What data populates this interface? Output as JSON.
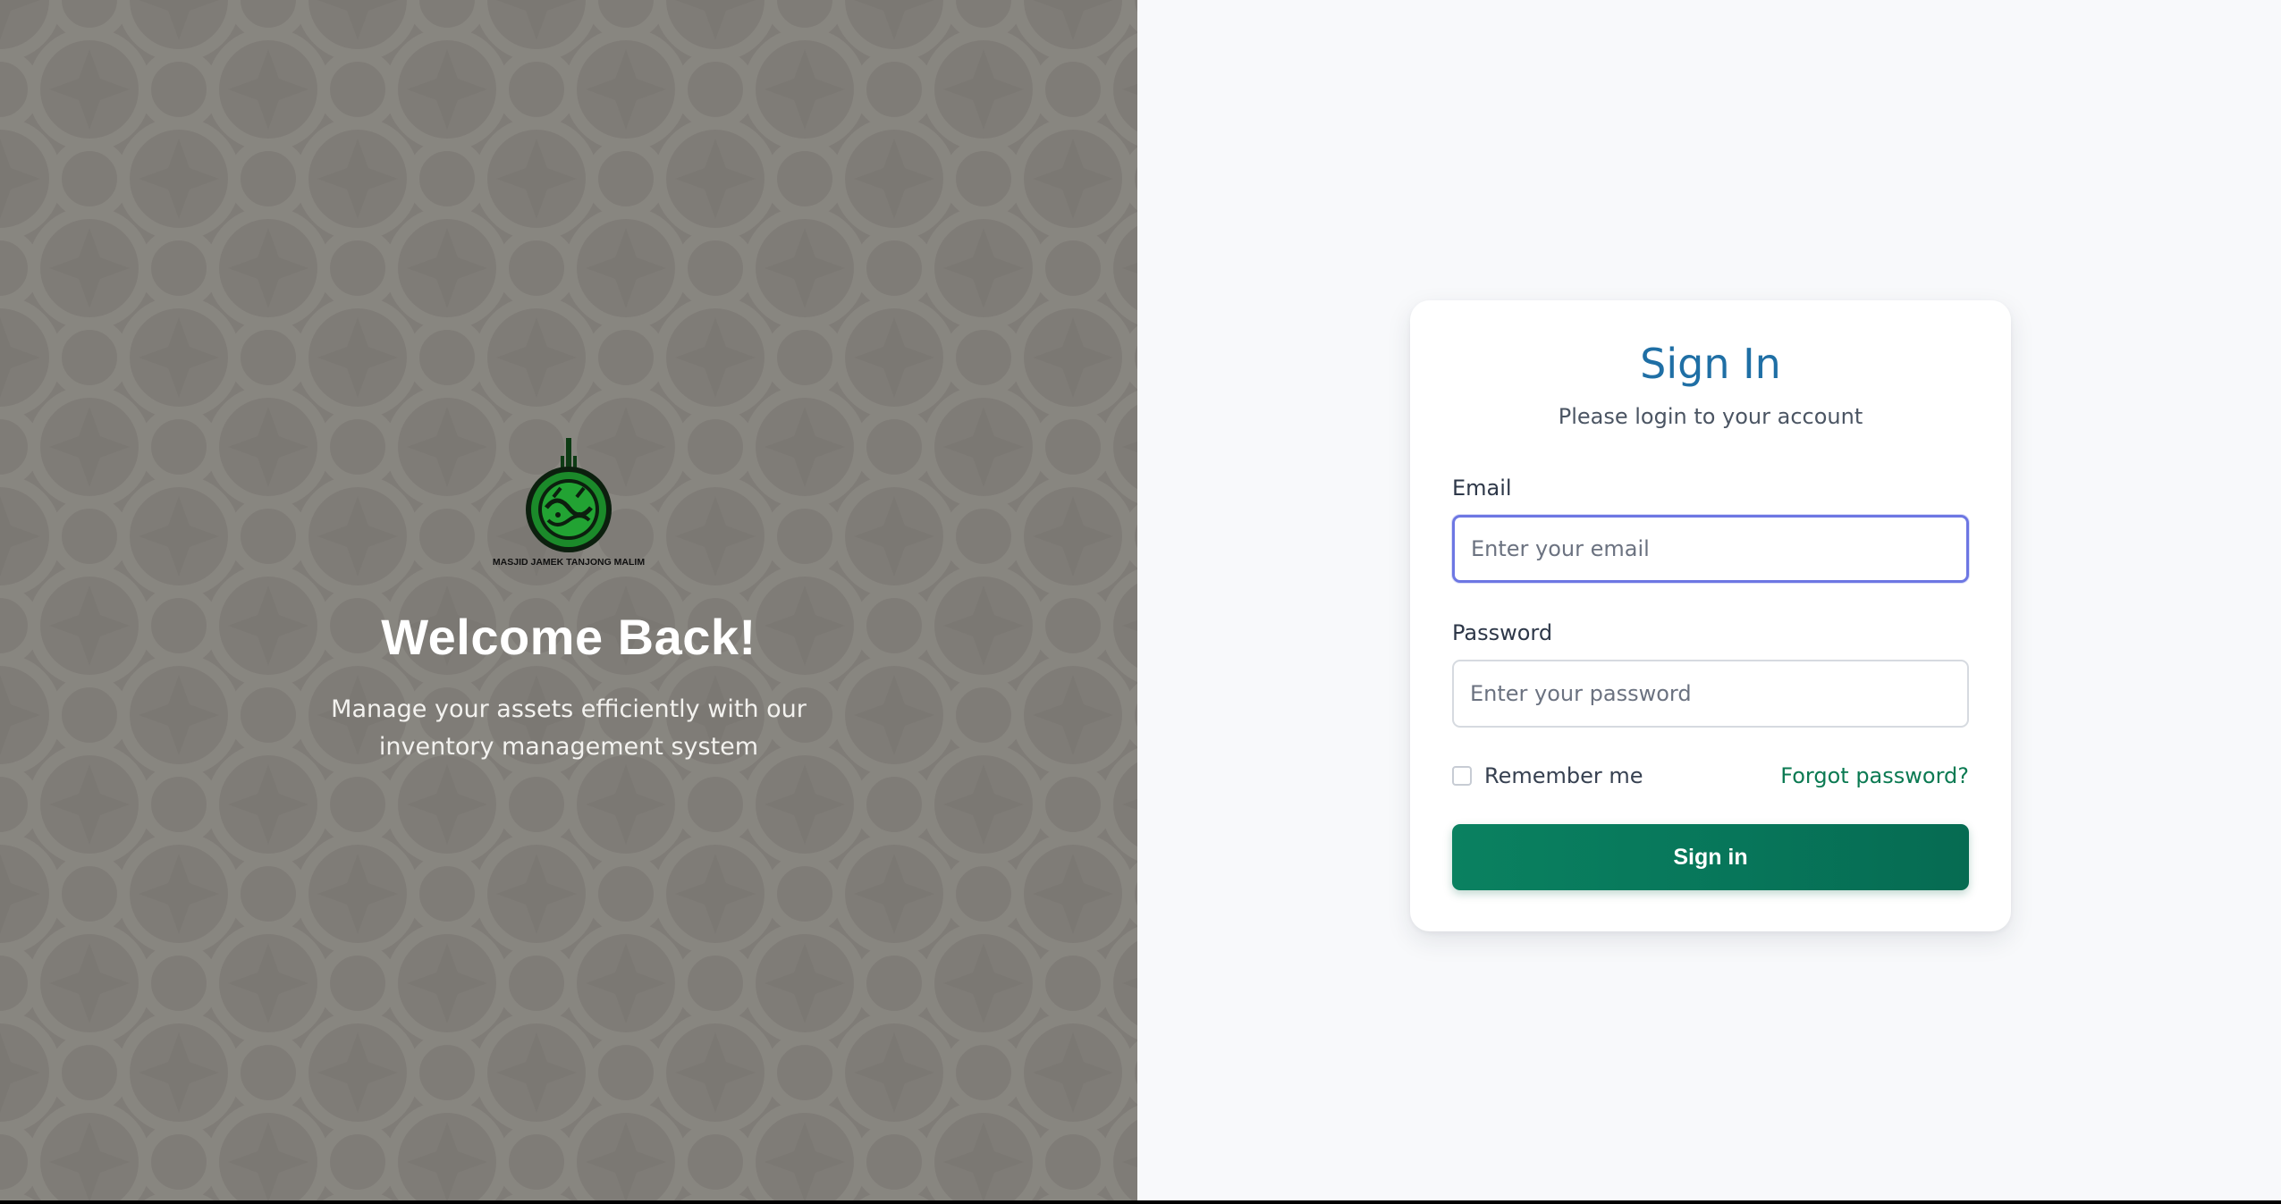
{
  "colors": {
    "hero_background": "#7f7c77",
    "title_blue": "#1f6fa5",
    "brand_green": "#0a8160",
    "link_green": "#0b7a52",
    "focus_ring": "#6d77e3"
  },
  "hero": {
    "logo_icon": "mosque-calligraphy-logo",
    "logo_caption": "MASJID JAMEK TANJONG MALIM",
    "title": "Welcome Back!",
    "subtitle": "Manage your assets efficiently with our inventory management system"
  },
  "login": {
    "title": "Sign In",
    "subtitle": "Please login to your account",
    "email_label": "Email",
    "email_placeholder": "Enter your email",
    "email_value": "",
    "password_label": "Password",
    "password_placeholder": "Enter your password",
    "password_value": "",
    "remember_label": "Remember me",
    "remember_checked": false,
    "forgot_label": "Forgot password?",
    "submit_label": "Sign in"
  }
}
